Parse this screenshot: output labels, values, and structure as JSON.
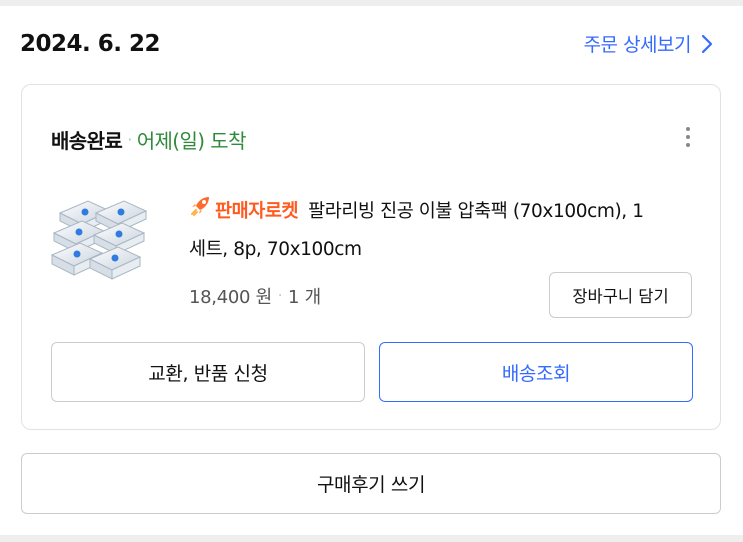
{
  "order": {
    "date": "2024. 6. 22",
    "detail_link_label": "주문 상세보기"
  },
  "status": {
    "main": "배송완료",
    "separator": "·",
    "arrival": "어제(일) 도착",
    "arrival_color": "#2f8b3b"
  },
  "product": {
    "badge_label": "판매자로켓",
    "badge_color": "#ff5a1f",
    "badge_icon": "rocket-icon",
    "name": "팔라리빙 진공 이불 압축팩 (70x100cm), 1세트, 8p, 70x100cm",
    "price": "18,400 원",
    "price_separator": "·",
    "quantity": "1 개",
    "thumbnail_icon": "vacuum-bag-stack-image"
  },
  "buttons": {
    "add_to_cart": "장바구니 담기",
    "exchange_return": "교환, 반품 신청",
    "track_delivery": "배송조회",
    "write_review": "구매후기 쓰기"
  },
  "colors": {
    "accent": "#346aff",
    "text": "#111111",
    "border": "#cccccc"
  }
}
